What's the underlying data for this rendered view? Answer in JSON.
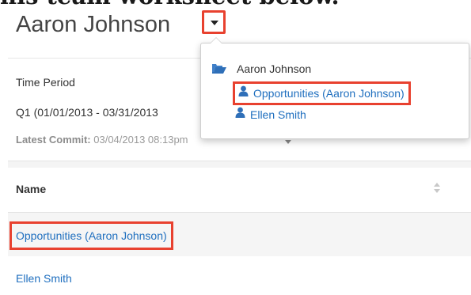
{
  "page_heading_cut": "his team worksheet below.",
  "worksheet": {
    "user_name": "Aaron Johnson"
  },
  "filters": {
    "time_period_label": "Time Period",
    "time_period_value": "Q1 (01/01/2013 - 03/31/2013",
    "latest_commit_label": "Latest Commit:",
    "latest_commit_value": "03/04/2013 08:13pm"
  },
  "table": {
    "column_name": "Name",
    "rows": [
      {
        "name": "Opportunities (Aaron Johnson)"
      },
      {
        "name": "Ellen Smith"
      }
    ]
  },
  "dropdown": {
    "root": {
      "label": "Aaron Johnson",
      "icon": "folder-icon"
    },
    "children": [
      {
        "label": "Opportunities (Aaron Johnson)",
        "icon": "person-icon"
      },
      {
        "label": "Ellen Smith",
        "icon": "person-icon"
      }
    ]
  },
  "colors": {
    "highlight": "#e8412f",
    "link": "#1f6fbf",
    "icon_blue": "#2f6fb8"
  }
}
